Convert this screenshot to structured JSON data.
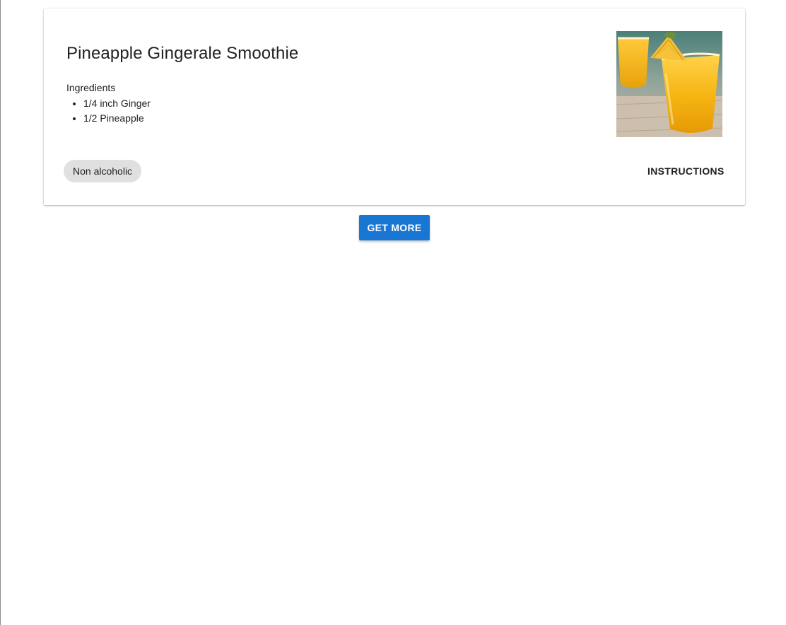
{
  "card": {
    "title": "Pineapple Gingerale Smoothie",
    "ingredients_label": "Ingredients",
    "ingredients": [
      "1/4 inch Ginger",
      "1/2 Pineapple"
    ],
    "tag": "Non alcoholic",
    "instructions_label": "INSTRUCTIONS",
    "image_icon": "smoothie-photo"
  },
  "actions": {
    "get_more_label": "GET MORE"
  },
  "colors": {
    "primary": "#1976d2",
    "chip_bg": "#e0e0e0",
    "text": "#202124"
  }
}
